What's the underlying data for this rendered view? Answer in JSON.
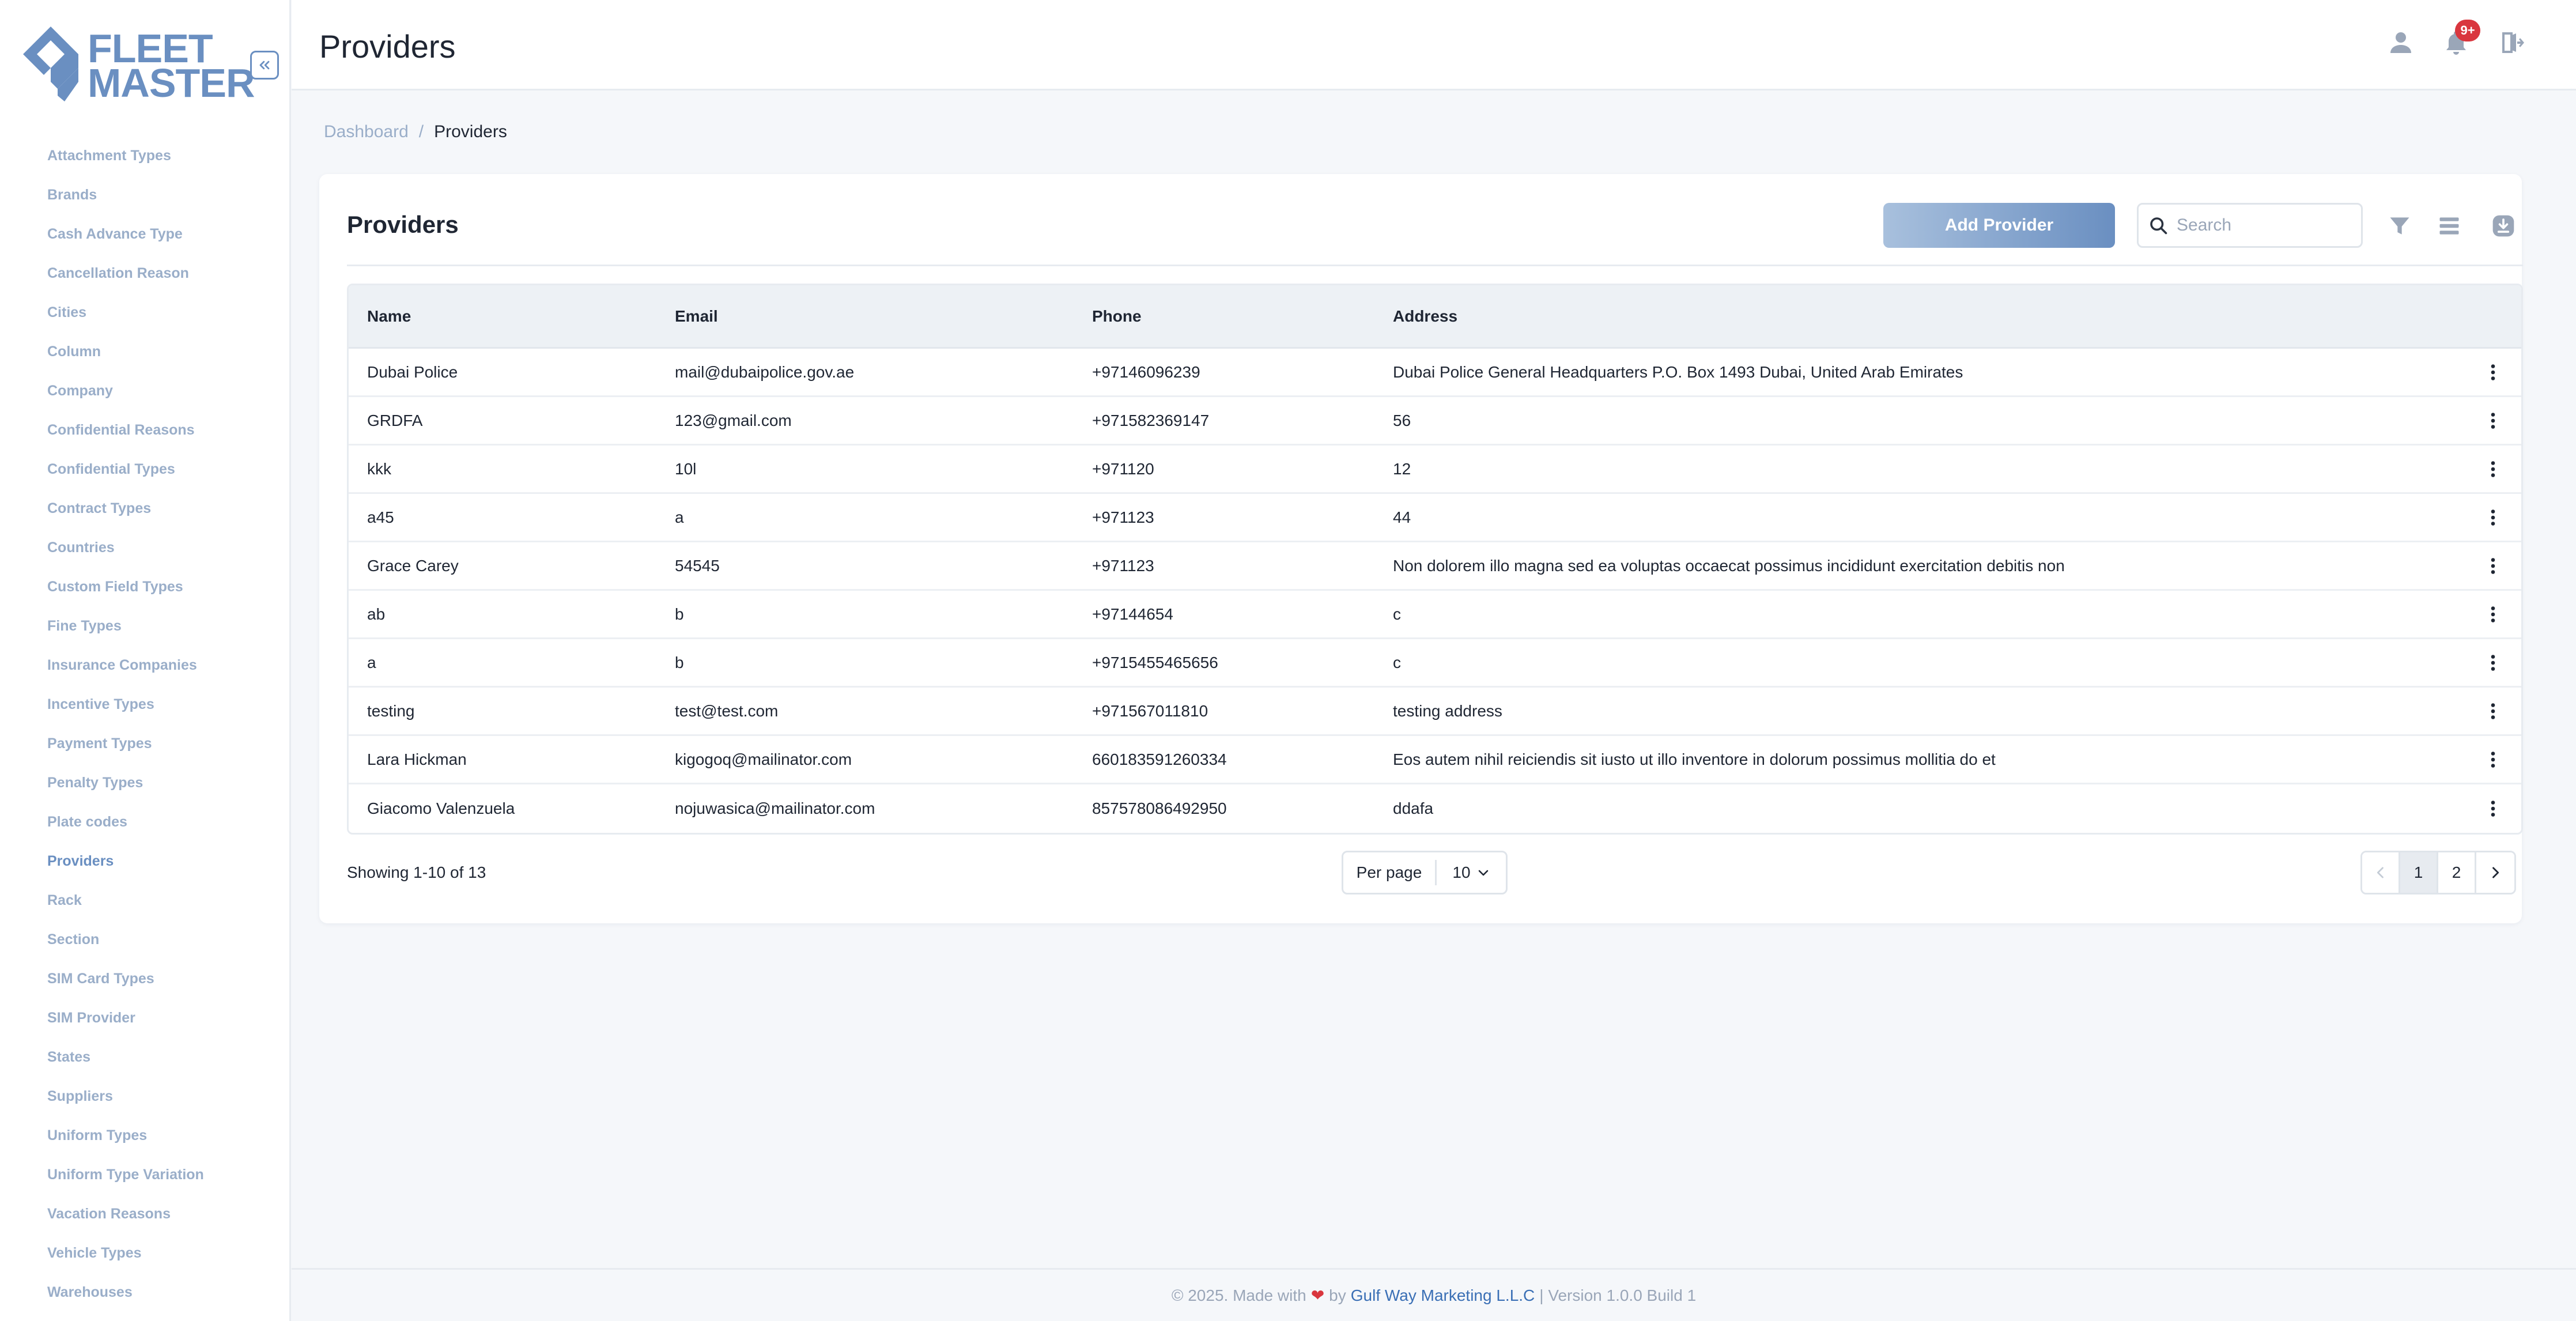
{
  "brand": {
    "line1": "FLEET",
    "line2": "MASTER",
    "color": "#6a8fc1"
  },
  "sidebar": {
    "collapse_icon": "chevrons-left-icon",
    "items": [
      {
        "label": "Attachment Types"
      },
      {
        "label": "Brands"
      },
      {
        "label": "Cash Advance Type"
      },
      {
        "label": "Cancellation Reason"
      },
      {
        "label": "Cities"
      },
      {
        "label": "Column"
      },
      {
        "label": "Company"
      },
      {
        "label": "Confidential Reasons"
      },
      {
        "label": "Confidential Types"
      },
      {
        "label": "Contract Types"
      },
      {
        "label": "Countries"
      },
      {
        "label": "Custom Field Types"
      },
      {
        "label": "Fine Types"
      },
      {
        "label": "Insurance Companies"
      },
      {
        "label": "Incentive Types"
      },
      {
        "label": "Payment Types"
      },
      {
        "label": "Penalty Types"
      },
      {
        "label": "Plate codes"
      },
      {
        "label": "Providers",
        "active": true
      },
      {
        "label": "Rack"
      },
      {
        "label": "Section"
      },
      {
        "label": "SIM Card Types"
      },
      {
        "label": "SIM Provider"
      },
      {
        "label": "States"
      },
      {
        "label": "Suppliers"
      },
      {
        "label": "Uniform Types"
      },
      {
        "label": "Uniform Type Variation"
      },
      {
        "label": "Vacation Reasons"
      },
      {
        "label": "Vehicle Types"
      },
      {
        "label": "Warehouses"
      }
    ]
  },
  "header": {
    "title": "Providers",
    "notification_badge": "9+",
    "icons": [
      "user-icon",
      "bell-icon",
      "logout-icon"
    ]
  },
  "breadcrumb": {
    "home": "Dashboard",
    "separator": "/",
    "current": "Providers"
  },
  "card": {
    "title": "Providers",
    "add_button": "Add Provider",
    "search_placeholder": "Search"
  },
  "table": {
    "columns": [
      "Name",
      "Email",
      "Phone",
      "Address"
    ],
    "rows": [
      {
        "name": "Dubai Police",
        "email": "mail@dubaipolice.gov.ae",
        "phone": "+97146096239",
        "address": "Dubai Police General Headquarters P.O. Box 1493 Dubai, United Arab Emirates"
      },
      {
        "name": "GRDFA",
        "email": "123@gmail.com",
        "phone": "+971582369147",
        "address": "56"
      },
      {
        "name": "kkk",
        "email": "10l",
        "phone": "+971120",
        "address": "12"
      },
      {
        "name": "a45",
        "email": "a",
        "phone": "+971123",
        "address": "44"
      },
      {
        "name": "Grace Carey",
        "email": "54545",
        "phone": "+971123",
        "address": "Non dolorem illo magna sed ea voluptas occaecat possimus incididunt exercitation debitis non"
      },
      {
        "name": "ab",
        "email": "b",
        "phone": "+97144654",
        "address": "c"
      },
      {
        "name": "a",
        "email": "b",
        "phone": "+9715455465656",
        "address": "c"
      },
      {
        "name": "testing",
        "email": "test@test.com",
        "phone": "+971567011810",
        "address": "testing address"
      },
      {
        "name": "Lara Hickman",
        "email": "kigogoq@mailinator.com",
        "phone": "660183591260334",
        "address": "Eos autem nihil reiciendis sit iusto ut illo inventore in dolorum possimus mollitia do et"
      },
      {
        "name": "Giacomo Valenzuela",
        "email": "nojuwasica@mailinator.com",
        "phone": "857578086492950",
        "address": "ddafa"
      }
    ]
  },
  "pagination": {
    "showing": "Showing 1-10 of 13",
    "per_page_label": "Per page",
    "per_page_value": "10",
    "pages": [
      "1",
      "2"
    ],
    "current_page": "1"
  },
  "footer": {
    "prefix": "© 2025. Made with",
    "by": "by",
    "company": "Gulf Way Marketing L.L.C",
    "version": "| Version 1.0.0 Build 1"
  }
}
